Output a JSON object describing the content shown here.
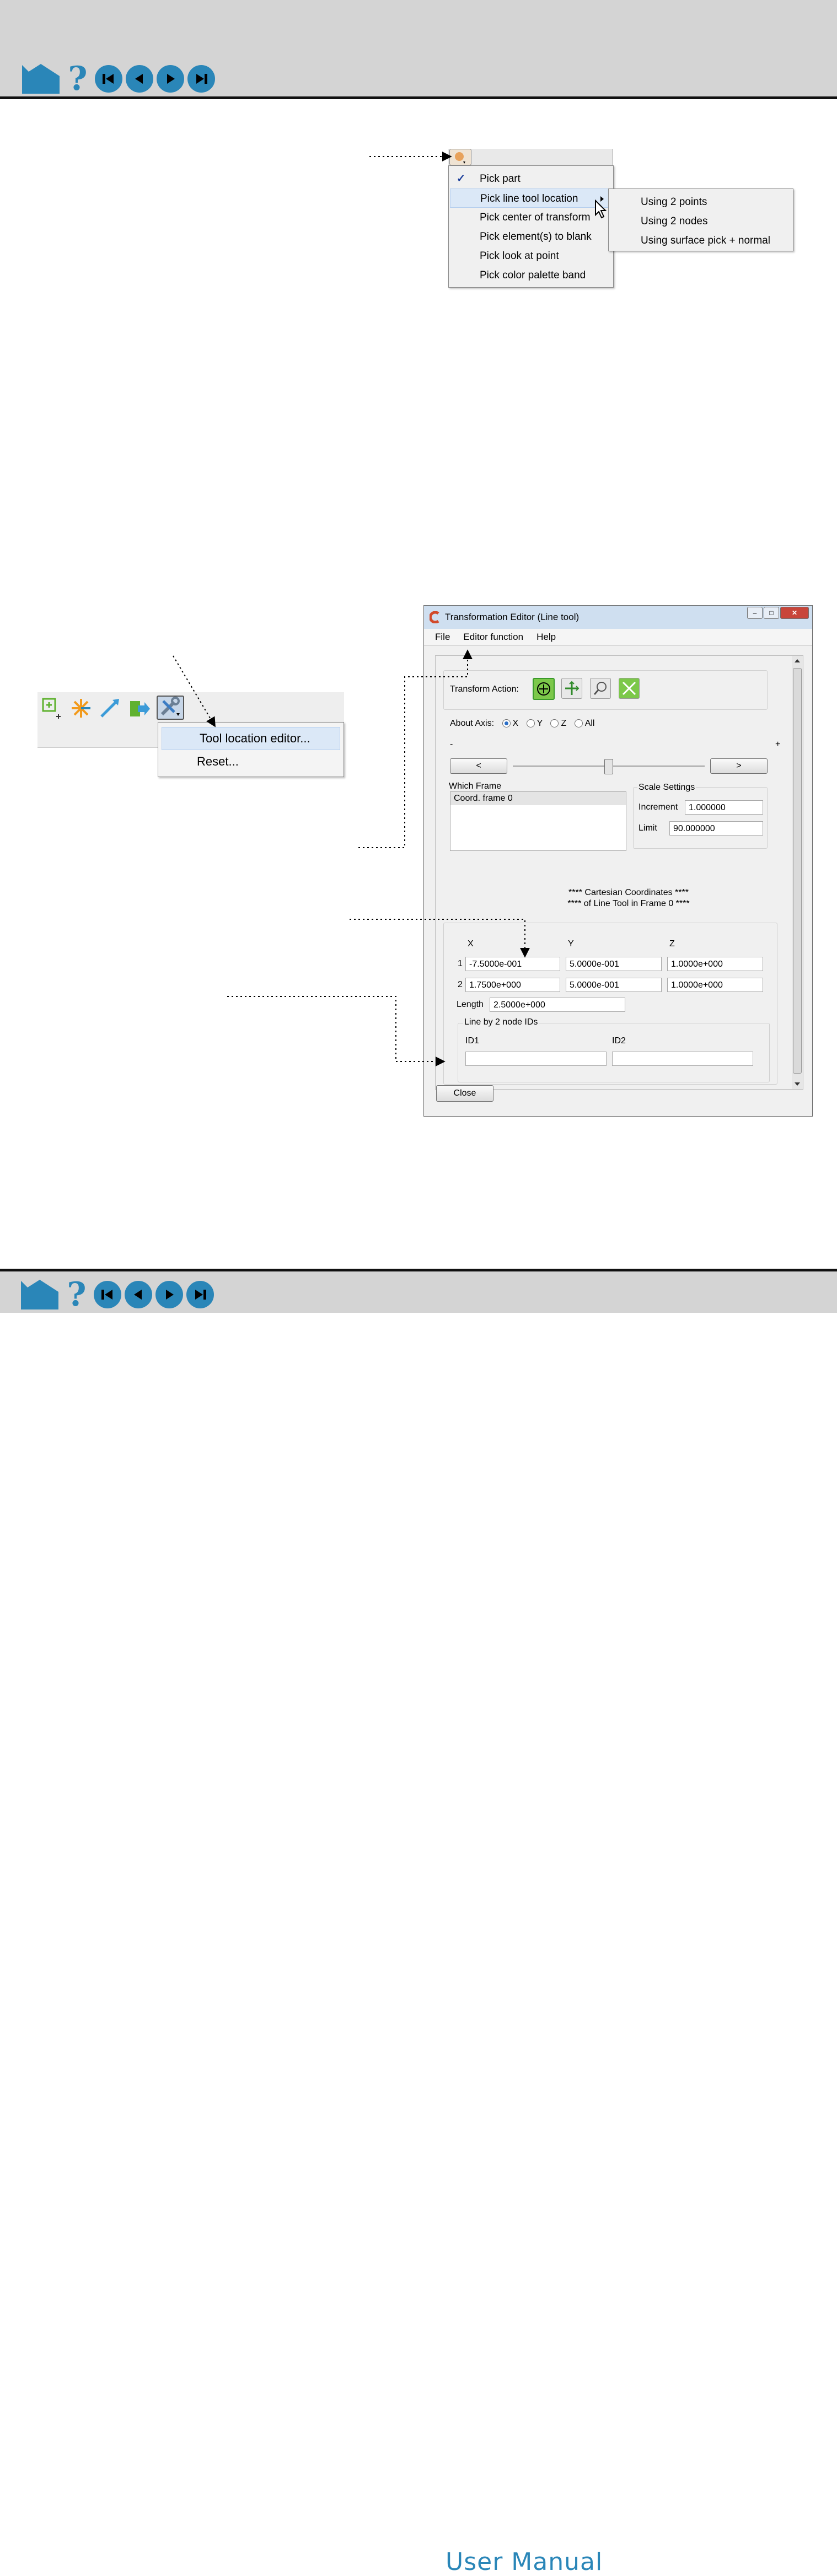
{
  "nav": {
    "icons": [
      "home-icon",
      "help-icon",
      "first-page-icon",
      "previous-page-icon",
      "next-page-icon",
      "last-page-icon"
    ],
    "help_glyph": "?",
    "footer_title": "User Manual",
    "accent_color": "#2a86b8"
  },
  "pick_menu": {
    "items": [
      {
        "label": "Pick part",
        "checked": true
      },
      {
        "label": "Pick line tool location",
        "submenu": true
      },
      {
        "label": "Pick center of transform"
      },
      {
        "label": "Pick element(s) to blank"
      },
      {
        "label": "Pick look at point"
      },
      {
        "label": "Pick color palette band"
      }
    ],
    "check_glyph": "✓",
    "submenu_items": [
      "Using 2 points",
      "Using 2 nodes",
      "Using surface pick + normal"
    ]
  },
  "tool_menu": {
    "items": [
      "Tool location editor...",
      "Reset..."
    ]
  },
  "editor": {
    "title": "Transformation Editor (Line tool)",
    "menu": [
      "File",
      "Editor function",
      "Help"
    ],
    "transform_action_label": "Transform Action:",
    "about_axis_label": "About Axis:",
    "axes": [
      "X",
      "Y",
      "Z",
      "All"
    ],
    "selected_axis": "X",
    "minus": "-",
    "plus": "+",
    "step_left": "<",
    "step_right": ">",
    "which_frame_label": "Which Frame",
    "frames": [
      "Coord. frame 0"
    ],
    "scale_settings_label": "Scale Settings",
    "increment_label": "Increment",
    "increment_value": "1.000000",
    "limit_label": "Limit",
    "limit_value": "90.000000",
    "coords_heading_1": "**** Cartesian Coordinates ****",
    "coords_heading_2": "**** of Line Tool in Frame 0 ****",
    "col_x": "X",
    "col_y": "Y",
    "col_z": "Z",
    "row1_label": "1",
    "row1": [
      "-7.5000e-001",
      "5.0000e-001",
      "1.0000e+000"
    ],
    "row2_label": "2",
    "row2": [
      "1.7500e+000",
      "5.0000e-001",
      "1.0000e+000"
    ],
    "length_label": "Length",
    "length_value": "2.5000e+000",
    "line_by_nodes_label": "Line by 2 node IDs",
    "id1_label": "ID1",
    "id2_label": "ID2",
    "id1_value": "",
    "id2_value": "",
    "close_label": "Close"
  }
}
